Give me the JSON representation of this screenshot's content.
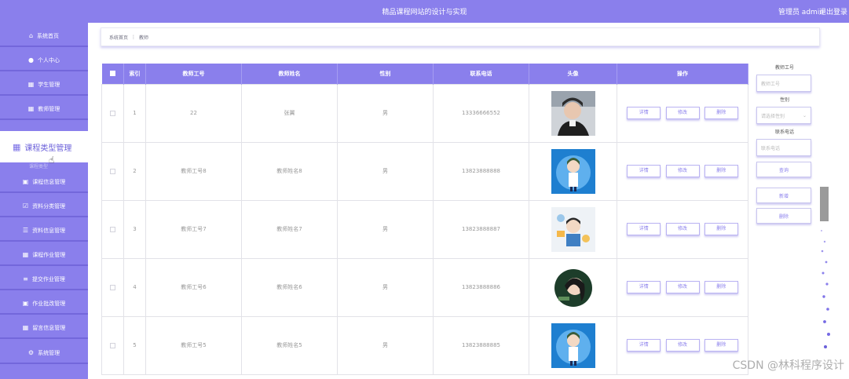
{
  "header": {
    "title": "精品课程网站的设计与实现",
    "user": "管理员 admin",
    "logout": "退出登录"
  },
  "sidebar": {
    "items": [
      {
        "label": "系统首页",
        "icon": "home-icon"
      },
      {
        "label": "个人中心",
        "icon": "user-icon"
      },
      {
        "label": "学生管理",
        "icon": "grid-icon"
      },
      {
        "label": "教师管理",
        "icon": "grid-icon"
      },
      {
        "label": "课程类型管理",
        "icon": "grid-icon"
      },
      {
        "label": "课程信息管理",
        "icon": "clipboard-icon"
      },
      {
        "label": "资料分类管理",
        "icon": "checkbox-icon"
      },
      {
        "label": "资料信息管理",
        "icon": "sliders-icon"
      },
      {
        "label": "课程作业管理",
        "icon": "grid-icon"
      },
      {
        "label": "提交作业管理",
        "icon": "list-icon"
      },
      {
        "label": "作业批改管理",
        "icon": "clipboard-icon"
      },
      {
        "label": "留言信息管理",
        "icon": "grid-icon"
      },
      {
        "label": "系统管理",
        "icon": "settings-icon"
      }
    ],
    "sub_item": "课程类型"
  },
  "breadcrumb": {
    "home": "系统首页",
    "sep": "⋮",
    "current": "教师"
  },
  "table": {
    "headers": [
      "",
      "索引",
      "教师工号",
      "教师姓名",
      "性别",
      "联系电话",
      "头像",
      "操作"
    ],
    "rows": [
      {
        "index": "1",
        "id": "22",
        "name": "张翼",
        "gender": "男",
        "phone": "13336666552"
      },
      {
        "index": "2",
        "id": "教师工号8",
        "name": "教师姓名8",
        "gender": "男",
        "phone": "13823888888"
      },
      {
        "index": "3",
        "id": "教师工号7",
        "name": "教师姓名7",
        "gender": "男",
        "phone": "13823888887"
      },
      {
        "index": "4",
        "id": "教师工号6",
        "name": "教师姓名6",
        "gender": "男",
        "phone": "13823888886"
      },
      {
        "index": "5",
        "id": "教师工号5",
        "name": "教师姓名5",
        "gender": "男",
        "phone": "13823888885"
      }
    ],
    "actions": {
      "detail": "详情",
      "edit": "修改",
      "delete": "删除"
    }
  },
  "search_panel": {
    "id_label": "教师工号",
    "id_placeholder": "教师工号",
    "gender_label": "性别",
    "gender_placeholder": "请选择性别",
    "phone_label": "联系电话",
    "phone_placeholder": "联系电话",
    "search": "查询",
    "add": "新增",
    "delete": "删除"
  },
  "watermark": "CSDN @林科程序设计",
  "colors": {
    "accent": "#8a7fec"
  }
}
